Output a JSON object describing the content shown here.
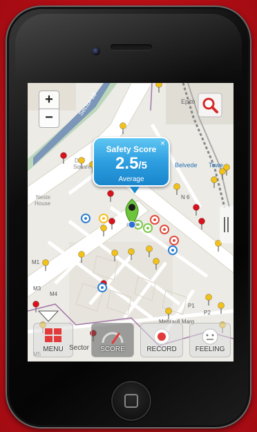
{
  "popup": {
    "title": "Safety Score",
    "score": "2.5",
    "denominator": "/5",
    "rating": "Average",
    "close": "×"
  },
  "map": {
    "labels": {
      "dlf_square": "DLF",
      "dlf_square2": "Square",
      "neste_house": "Neste",
      "neste_house2": "House",
      "epitome": "Epito",
      "belvedere": "Belvede",
      "tower": "Towe",
      "sector": "Sector",
      "n6": "N 6",
      "m1": "M1",
      "m3": "M3",
      "m4": "M4",
      "p1": "P1",
      "p2": "P2",
      "marg": "Mehrauli Marg",
      "m5": "M5",
      "sector18": "Sector 18"
    }
  },
  "zoom": {
    "plus": "+",
    "minus": "−"
  },
  "toolbar": {
    "menu": "MENU",
    "score": "SCORE",
    "record": "RECORD",
    "feeling": "FEELING"
  },
  "icons": [
    "search-icon",
    "close-icon",
    "menu-grid-icon",
    "gauge-icon",
    "record-icon",
    "face-icon",
    "home-icon"
  ],
  "colors": {
    "background": "#c8131b",
    "popup": "#2d9ee0",
    "pin_yellow": "#f2c21b",
    "pin_red": "#d8121b"
  }
}
